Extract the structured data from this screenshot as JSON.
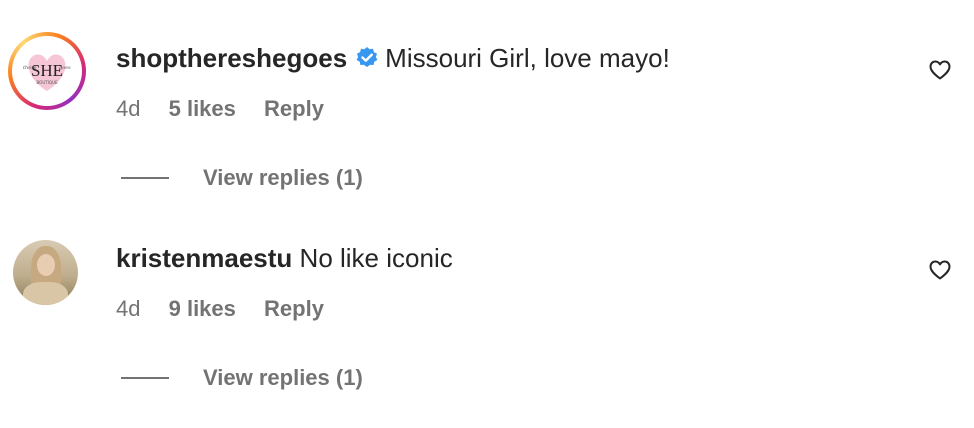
{
  "comments": [
    {
      "username": "shopthereshegoes",
      "verified": true,
      "text": "Missouri Girl, love mayo!",
      "time": "4d",
      "likes": "5 likes",
      "reply_label": "Reply",
      "view_replies": "View replies (1)",
      "avatar_logo_text": "SHE",
      "avatar_logo_script": "there she goes",
      "avatar_logo_sub": "BOUTIQUE"
    },
    {
      "username": "kristenmaestu",
      "verified": false,
      "text": "No like iconic",
      "time": "4d",
      "likes": "9 likes",
      "reply_label": "Reply",
      "view_replies": "View replies (1)"
    }
  ],
  "colors": {
    "text_primary": "#262626",
    "text_secondary": "#737373",
    "verified_blue": "#3897f0",
    "logo_pink": "#f6c5d6"
  },
  "icons": [
    "verified-badge-icon",
    "heart-icon"
  ]
}
